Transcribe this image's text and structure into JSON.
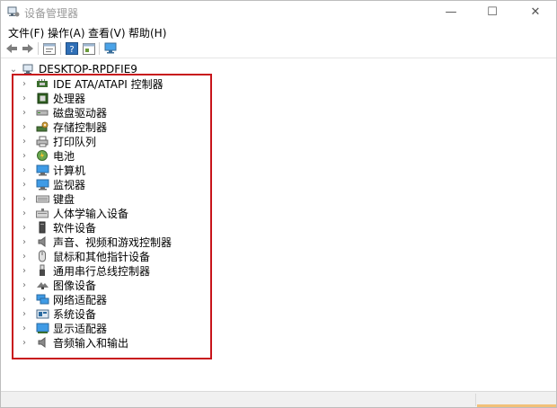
{
  "window": {
    "title": "设备管理器"
  },
  "caption": {
    "minimize": "—",
    "maximize": "☐",
    "close": "✕"
  },
  "menu": [
    {
      "label": "文件(F)"
    },
    {
      "label": "操作(A)"
    },
    {
      "label": "查看(V)"
    },
    {
      "label": "帮助(H)"
    }
  ],
  "toolbar": [
    "back-icon",
    "forward-icon",
    "properties-icon",
    "help-icon",
    "update-driver-icon",
    "monitor-scan-icon"
  ],
  "tree": {
    "root": "DESKTOP-RPDFIE9",
    "root_expander": "⌄",
    "expander": "›",
    "categories": [
      {
        "label": "IDE ATA/ATAPI 控制器",
        "icon": "ide-controller-icon"
      },
      {
        "label": "处理器",
        "icon": "processor-icon"
      },
      {
        "label": "磁盘驱动器",
        "icon": "disk-drive-icon"
      },
      {
        "label": "存储控制器",
        "icon": "storage-controller-icon"
      },
      {
        "label": "打印队列",
        "icon": "printer-icon"
      },
      {
        "label": "电池",
        "icon": "battery-icon"
      },
      {
        "label": "计算机",
        "icon": "computer-icon"
      },
      {
        "label": "监视器",
        "icon": "monitor-icon"
      },
      {
        "label": "键盘",
        "icon": "keyboard-icon"
      },
      {
        "label": "人体学输入设备",
        "icon": "hid-icon"
      },
      {
        "label": "软件设备",
        "icon": "software-device-icon"
      },
      {
        "label": "声音、视频和游戏控制器",
        "icon": "sound-icon"
      },
      {
        "label": "鼠标和其他指针设备",
        "icon": "mouse-icon"
      },
      {
        "label": "通用串行总线控制器",
        "icon": "usb-icon"
      },
      {
        "label": "图像设备",
        "icon": "camera-icon"
      },
      {
        "label": "网络适配器",
        "icon": "network-adapter-icon"
      },
      {
        "label": "系统设备",
        "icon": "system-device-icon"
      },
      {
        "label": "显示适配器",
        "icon": "display-adapter-icon"
      },
      {
        "label": "音频输入和输出",
        "icon": "audio-io-icon"
      }
    ]
  },
  "colors": {
    "highlight": "#c8141b",
    "accent_blue": "#1e88d8"
  }
}
